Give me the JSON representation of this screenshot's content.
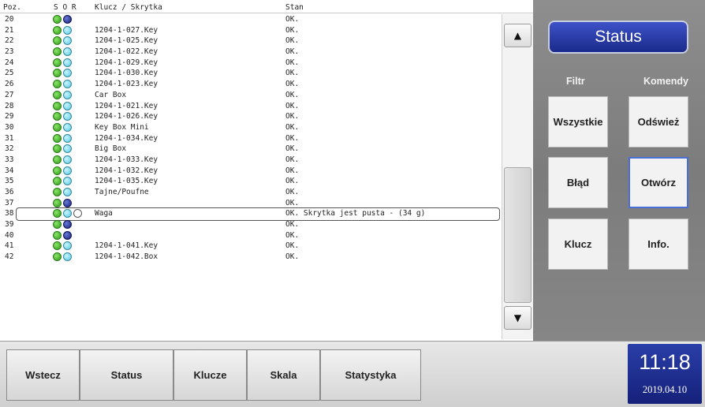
{
  "list": {
    "headers": {
      "pos": "Poz.",
      "sor": "S O R",
      "name": "Klucz / Skrytka",
      "state": "Stan"
    },
    "rows": [
      {
        "pos": "20",
        "name": "",
        "state": "OK.",
        "dots": [
          "green",
          "blue"
        ]
      },
      {
        "pos": "21",
        "name": "1204-1-027.Key",
        "state": "OK.",
        "dots": [
          "green",
          "cyan"
        ]
      },
      {
        "pos": "22",
        "name": "1204-1-025.Key",
        "state": "OK.",
        "dots": [
          "green",
          "cyan"
        ]
      },
      {
        "pos": "23",
        "name": "1204-1-022.Key",
        "state": "OK.",
        "dots": [
          "green",
          "cyan"
        ]
      },
      {
        "pos": "24",
        "name": "1204-1-029.Key",
        "state": "OK.",
        "dots": [
          "green",
          "cyan"
        ]
      },
      {
        "pos": "25",
        "name": "1204-1-030.Key",
        "state": "OK.",
        "dots": [
          "green",
          "cyan"
        ]
      },
      {
        "pos": "26",
        "name": "1204-1-023.Key",
        "state": "OK.",
        "dots": [
          "green",
          "cyan"
        ]
      },
      {
        "pos": "27",
        "name": "Car Box",
        "state": "OK.",
        "dots": [
          "green",
          "cyan"
        ]
      },
      {
        "pos": "28",
        "name": "1204-1-021.Key",
        "state": "OK.",
        "dots": [
          "green",
          "cyan"
        ]
      },
      {
        "pos": "29",
        "name": "1204-1-026.Key",
        "state": "OK.",
        "dots": [
          "green",
          "cyan"
        ]
      },
      {
        "pos": "30",
        "name": "Key Box Mini",
        "state": "OK.",
        "dots": [
          "green",
          "cyan"
        ]
      },
      {
        "pos": "31",
        "name": "1204-1-034.Key",
        "state": "OK.",
        "dots": [
          "green",
          "cyan"
        ]
      },
      {
        "pos": "32",
        "name": "Big Box",
        "state": "OK.",
        "dots": [
          "green",
          "cyan"
        ]
      },
      {
        "pos": "33",
        "name": "1204-1-033.Key",
        "state": "OK.",
        "dots": [
          "green",
          "cyan"
        ]
      },
      {
        "pos": "34",
        "name": "1204-1-032.Key",
        "state": "OK.",
        "dots": [
          "green",
          "cyan"
        ]
      },
      {
        "pos": "35",
        "name": "1204-1-035.Key",
        "state": "OK.",
        "dots": [
          "green",
          "cyan"
        ]
      },
      {
        "pos": "36",
        "name": "Tajne/Poufne",
        "state": "OK.",
        "dots": [
          "green",
          "cyan"
        ]
      },
      {
        "pos": "37",
        "name": "",
        "state": "OK.",
        "dots": [
          "green",
          "blue"
        ]
      },
      {
        "pos": "38",
        "name": "Waga",
        "state": "OK. Skrytka jest pusta - (34 g)",
        "dots": [
          "green",
          "cyan",
          "empty"
        ],
        "selected": true
      },
      {
        "pos": "39",
        "name": "",
        "state": "OK.",
        "dots": [
          "green",
          "blue"
        ]
      },
      {
        "pos": "40",
        "name": "",
        "state": "OK.",
        "dots": [
          "green",
          "blue"
        ]
      },
      {
        "pos": "41",
        "name": "1204-1-041.Key",
        "state": "OK.",
        "dots": [
          "green",
          "cyan"
        ]
      },
      {
        "pos": "42",
        "name": "1204-1-042.Box",
        "state": "OK.",
        "dots": [
          "green",
          "cyan"
        ]
      }
    ],
    "scroll_up_icon": "▲",
    "scroll_down_icon": "▼"
  },
  "right_panel": {
    "title": "Status",
    "filter_label": "Filtr",
    "commands_label": "Komendy",
    "buttons": {
      "all": "Wszystkie",
      "refresh": "Odśwież",
      "error": "Błąd",
      "open": "Otwórz",
      "key": "Klucz",
      "info": "Info."
    }
  },
  "bottom_nav": {
    "back": "Wstecz",
    "status": "Status",
    "keys": "Klucze",
    "scale": "Skala",
    "statistics": "Statystyka"
  },
  "clock": {
    "time": "11:18",
    "date": "2019.04.10"
  },
  "colors": {
    "accent_blue": "#1a2a8a",
    "status_green": "#2f9a16",
    "status_cyan": "#5cc9e0",
    "status_dark_blue": "#15207a"
  }
}
